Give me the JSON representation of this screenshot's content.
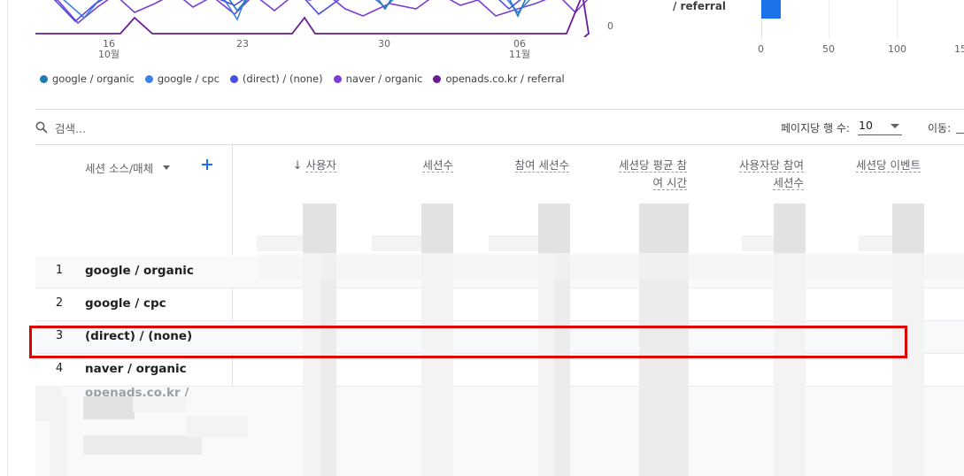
{
  "chart": {
    "x_ticks": [
      {
        "day": "16",
        "month": "10월"
      },
      {
        "day": "23",
        "month": ""
      },
      {
        "day": "30",
        "month": ""
      },
      {
        "day": "06",
        "month": "11월"
      }
    ],
    "y_zero": "0",
    "legend": [
      {
        "label": "google / organic",
        "color": "#1e7bb8"
      },
      {
        "label": "google / cpc",
        "color": "#3b82e6"
      },
      {
        "label": "(direct) / (none)",
        "color": "#4b4fe0"
      },
      {
        "label": "naver / organic",
        "color": "#7b3fd3"
      },
      {
        "label": "openads.co.kr / referral",
        "color": "#6a1b9a"
      }
    ]
  },
  "bar_panel": {
    "label": "/ referral",
    "x_ticks": [
      "0",
      "50",
      "100",
      "15"
    ],
    "bar_color": "#1a73e8"
  },
  "toolbar": {
    "search_placeholder": "검색...",
    "rows_label": "페이지당 행 수:",
    "rows_value": "10",
    "goto_label": "이동:"
  },
  "table": {
    "dimension_header": "세션 소스/매체",
    "columns": [
      {
        "line1": "사용자",
        "line2": "",
        "sorted": true
      },
      {
        "line1": "세션수",
        "line2": "",
        "sorted": false
      },
      {
        "line1": "참여 세션수",
        "line2": "",
        "sorted": false
      },
      {
        "line1": "세션당 평균 참",
        "line2": "여 시간",
        "sorted": false
      },
      {
        "line1": "사용자당 참여",
        "line2": "세션수",
        "sorted": false
      },
      {
        "line1": "세션당 이벤트",
        "line2": "",
        "sorted": false
      }
    ],
    "rows": [
      {
        "index": "1",
        "name": "google / organic"
      },
      {
        "index": "2",
        "name": "google / cpc"
      },
      {
        "index": "3",
        "name": "(direct) / (none)"
      },
      {
        "index": "4",
        "name": "naver / organic"
      },
      {
        "index": "",
        "name": "openads.co.kr /"
      }
    ]
  },
  "highlight": {
    "row_index": "3",
    "color": "#e00000"
  }
}
